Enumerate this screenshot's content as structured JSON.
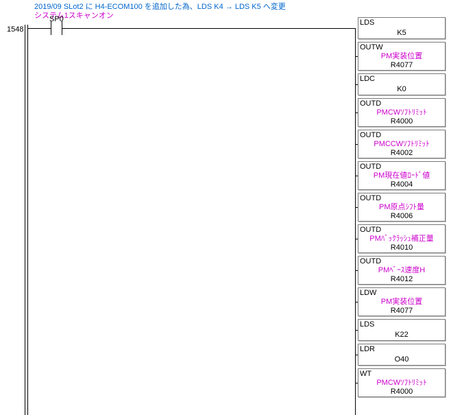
{
  "comment1": "2019/09 SLot2 に H4-ECOM100 を追加した為、LDS  K4 → LDS K5 へ変更",
  "comment2": "システム1スキャンオン",
  "rung_number": "1548",
  "contact": {
    "label": "SP0"
  },
  "blocks": [
    {
      "mnemonic": "LDS",
      "param": "",
      "operand": "K5"
    },
    {
      "mnemonic": "OUTW",
      "param": "PM実装位置",
      "operand": "R4077"
    },
    {
      "mnemonic": "LDC",
      "param": "",
      "operand": "K0"
    },
    {
      "mnemonic": "OUTD",
      "param": "PMCWｿﾌﾄﾘﾐｯﾄ",
      "operand": "R4000"
    },
    {
      "mnemonic": "OUTD",
      "param": "PMCCWｿﾌﾄﾘﾐｯﾄ",
      "operand": "R4002"
    },
    {
      "mnemonic": "OUTD",
      "param": "PM現在値ﾛｰﾄﾞ値",
      "operand": "R4004"
    },
    {
      "mnemonic": "OUTD",
      "param": "PM原点ｼﾌﾄ量",
      "operand": "R4006"
    },
    {
      "mnemonic": "OUTD",
      "param": "PMﾊﾞｯｸﾗｯｼｭ補正量",
      "operand": "R4010"
    },
    {
      "mnemonic": "OUTD",
      "param": "PMﾍﾞｰｽ速度H",
      "operand": "R4012"
    },
    {
      "mnemonic": "LDW",
      "param": "PM実装位置",
      "operand": "R4077"
    },
    {
      "mnemonic": "LDS",
      "param": "",
      "operand": "K22"
    },
    {
      "mnemonic": "LDR",
      "param": "",
      "operand": "O40"
    },
    {
      "mnemonic": "WT",
      "param": "PMCWｿﾌﾄﾘﾐｯﾄ",
      "operand": "R4000"
    }
  ]
}
